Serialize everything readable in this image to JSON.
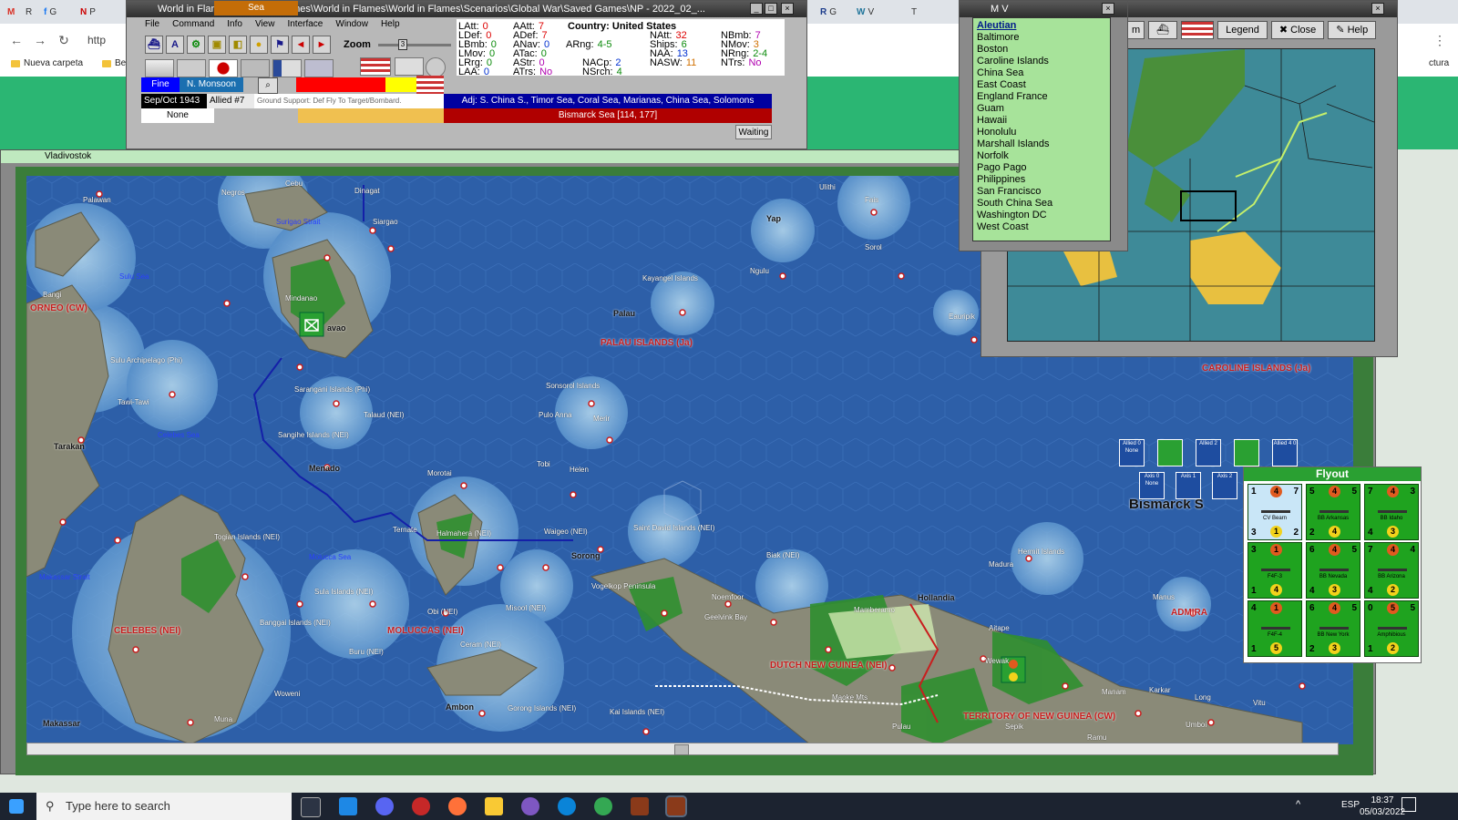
{
  "browser": {
    "tab_labels": [
      "M",
      "R",
      "G",
      "P",
      "H",
      "G",
      "V",
      "T"
    ],
    "url_fragment": "http",
    "bookmark_folder": "Nueva carpeta",
    "bookmark_other": "Be",
    "right_label": "ctura"
  },
  "wif": {
    "title": "World in Flames [C:\\Matrix Games\\World in Flames\\World in Flames\\Scenarios\\Global War\\Saved Games\\NP - 2022_02_...",
    "menu": [
      "File",
      "Command",
      "Info",
      "View",
      "Interface",
      "Window",
      "Help"
    ],
    "zoom_label": "Zoom",
    "zoom_value": "3",
    "country_label": "Country: United States",
    "stats": {
      "LAtt": "0",
      "LDef": "0",
      "LBmb": "0",
      "LMov": "0",
      "LRrg": "0",
      "LAA": "0",
      "AAtt": "7",
      "ADef": "7",
      "ANav": "0",
      "ATac": "0",
      "AStr": "0",
      "ATrs": "No",
      "ARng": "4-5",
      "NACp": "2",
      "NSrch": "4",
      "NAtt": "32",
      "Ships": "6",
      "NAA": "13",
      "NASW": "11",
      "NBmb": "7",
      "NMov": "3",
      "NRng": "2-4",
      "NTrs": "No"
    },
    "weather": "Fine",
    "weather_zone": "N. Monsoon",
    "date": "Sep/Oct 1943",
    "impulse": "Allied #7",
    "ground_support": "Ground Support: Def Fly To Target/Bombard.",
    "adjacent": "Adj: S. China S., Timor Sea, Coral Sea, Marianas, China Sea, Solomons",
    "hex_none": "None",
    "hex_type": "Sea",
    "location": "Bismarck Sea [114, 177]",
    "status": "Waiting"
  },
  "mapwin": {
    "title": "Vladivostok"
  },
  "mv": {
    "title": "M V",
    "items": [
      "Aleutian",
      "Baltimore",
      "Boston",
      "Caroline Islands",
      "China Sea",
      "East Coast",
      "England France",
      "Guam",
      "Hawaii",
      "Honolulu",
      "Marshall Islands",
      "Norfolk",
      "Pago Pago",
      "Philippines",
      "San Francisco",
      "South China Sea",
      "Washington DC",
      "West Coast"
    ]
  },
  "overview": {
    "legend": "Legend",
    "close": "Close",
    "help": "Help",
    "m_label": "m"
  },
  "map_labels": {
    "regions": [
      "ORNEO (CW)",
      "PALAU ISLANDS (Ja)",
      "CELEBES (NEI)",
      "MOLUCCAS (NEI)",
      "DUTCH NEW GUINEA (NEI)",
      "TERRITORY OF NEW GUINEA (CW)",
      "CAROLINE ISLANDS (Ja)",
      "ADMIRA"
    ],
    "seas": [
      "Sulu Sea",
      "Celebes Sea",
      "Molucca Sea",
      "Makassar Strait",
      "Surigao Strait"
    ],
    "cities": [
      "Tarakan",
      "Menado",
      "Makassar",
      "Ambon",
      "Sorong",
      "Hollandia",
      "Palau",
      "Yap",
      "avao"
    ],
    "places": [
      "Palawan",
      "Negros",
      "Cebu",
      "Dinagat",
      "Siargao",
      "Mindanao",
      "Sulu Archipelago (Phi)",
      "Tawi-Tawi",
      "Sarangani Islands (Phi)",
      "Talaud (NEI)",
      "Sangihe Islands (NEI)",
      "Togian Islands (NEI)",
      "Sula Islands (NEI)",
      "Banggai Islands (NEI)",
      "Obi (NEI)",
      "Buru (NEI)",
      "Ceram (NEI)",
      "Gorong Islands (NEI)",
      "Kai Islands (NEI)",
      "Morotai",
      "Halmahera (NEI)",
      "Ternate",
      "Waigeo (NEI)",
      "Misool (NEI)",
      "Vogelkop Peninsula",
      "Saint David Islands (NEI)",
      "Tobi",
      "Helen",
      "Pulo Anna",
      "Merir",
      "Sonsorol Islands",
      "Kayangel Islands",
      "Biak (NEI)",
      "Noemfoor",
      "Geelvink Bay",
      "Madura",
      "Hermit Islands",
      "Manus",
      "Aitape",
      "Wewak",
      "Maoke Mts",
      "Mamberamo",
      "Pulau",
      "Sepik",
      "Ramu",
      "Karkar",
      "Manam",
      "Long",
      "Umboi",
      "Vitu",
      "Ulithi",
      "Fais",
      "Ngulu",
      "Sorol",
      "Eauripik",
      "Woweni",
      "Muna",
      "Bangi"
    ]
  },
  "bismarck": "Bismarck S",
  "flyout": {
    "title": "Flyout",
    "units": [
      {
        "name": "CV Bearn",
        "a": "1",
        "b": "4",
        "c": "7",
        "d": "1",
        "e": "3",
        "f": "2",
        "color": "blue"
      },
      {
        "name": "BB Arkansas",
        "a": "5",
        "b": "4",
        "c": "5",
        "d": "4",
        "e": "2",
        "f": "",
        "color": "green"
      },
      {
        "name": "BB Idaho",
        "a": "7",
        "b": "4",
        "c": "3",
        "d": "3",
        "e": "4",
        "f": "",
        "color": "green"
      },
      {
        "name": "F4F-3",
        "a": "3",
        "b": "1",
        "c": "",
        "d": "4",
        "e": "1",
        "f": "",
        "color": "green"
      },
      {
        "name": "BB Nevada",
        "a": "6",
        "b": "4",
        "c": "5",
        "d": "3",
        "e": "4",
        "f": "",
        "color": "green"
      },
      {
        "name": "BB Arizona",
        "a": "7",
        "b": "4",
        "c": "4",
        "d": "2",
        "e": "4",
        "f": "",
        "color": "green"
      },
      {
        "name": "F4F-4",
        "a": "4",
        "b": "1",
        "c": "",
        "d": "5",
        "e": "1",
        "f": "",
        "color": "green"
      },
      {
        "name": "BB New York",
        "a": "6",
        "b": "4",
        "c": "5",
        "d": "3",
        "e": "2",
        "f": "",
        "color": "green"
      },
      {
        "name": "Amphibious",
        "a": "0",
        "b": "5",
        "c": "5",
        "d": "2",
        "e": "1",
        "f": "",
        "color": "green"
      }
    ],
    "stack_boxes": [
      "Allied 0 None",
      "Allied 2",
      "Allied 4 0",
      "Axis 0 None",
      "Axis 1",
      "Axis 2"
    ]
  },
  "taskbar": {
    "search": "Type here to search",
    "lang": "ESP",
    "time": "18:37",
    "date": "05/03/2022"
  },
  "colors": {
    "sea": "#2d5fa8",
    "land": "#7b7b6a",
    "jungle": "#2f8f2f",
    "flyout_green": "#2aa032"
  }
}
